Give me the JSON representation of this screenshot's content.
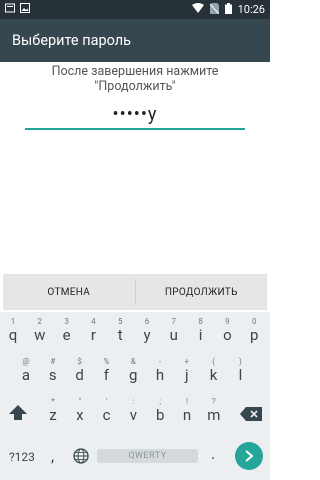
{
  "status": {
    "time": "10:26"
  },
  "toolbar": {
    "title": "Выберите пароль"
  },
  "prompt": {
    "line1": "После завершения нажмите",
    "line2": "\"Продолжить\""
  },
  "password": {
    "value": "•••••y"
  },
  "buttons": {
    "cancel": "ОТМЕНА",
    "continue": "ПРОДОЛЖИТЬ"
  },
  "keyboard": {
    "row1": [
      {
        "main": "q",
        "hint": "1"
      },
      {
        "main": "w",
        "hint": "2"
      },
      {
        "main": "e",
        "hint": "3"
      },
      {
        "main": "r",
        "hint": "4"
      },
      {
        "main": "t",
        "hint": "5"
      },
      {
        "main": "y",
        "hint": "6"
      },
      {
        "main": "u",
        "hint": "7"
      },
      {
        "main": "i",
        "hint": "8"
      },
      {
        "main": "o",
        "hint": "9"
      },
      {
        "main": "p",
        "hint": "0"
      }
    ],
    "row2": [
      {
        "main": "a",
        "hint": "@"
      },
      {
        "main": "s",
        "hint": "#"
      },
      {
        "main": "d",
        "hint": "$"
      },
      {
        "main": "f",
        "hint": "%"
      },
      {
        "main": "g",
        "hint": "&"
      },
      {
        "main": "h",
        "hint": "-"
      },
      {
        "main": "j",
        "hint": "+"
      },
      {
        "main": "k",
        "hint": "("
      },
      {
        "main": "l",
        "hint": ")"
      }
    ],
    "row3": [
      {
        "main": "z",
        "hint": "*"
      },
      {
        "main": "x",
        "hint": "\""
      },
      {
        "main": "c",
        "hint": "'"
      },
      {
        "main": "v",
        "hint": ":"
      },
      {
        "main": "b",
        "hint": ";"
      },
      {
        "main": "n",
        "hint": "!"
      },
      {
        "main": "m",
        "hint": "?"
      }
    ],
    "sym_label": "?123",
    "comma": ",",
    "space_label": "QWERTY",
    "dot": "."
  }
}
